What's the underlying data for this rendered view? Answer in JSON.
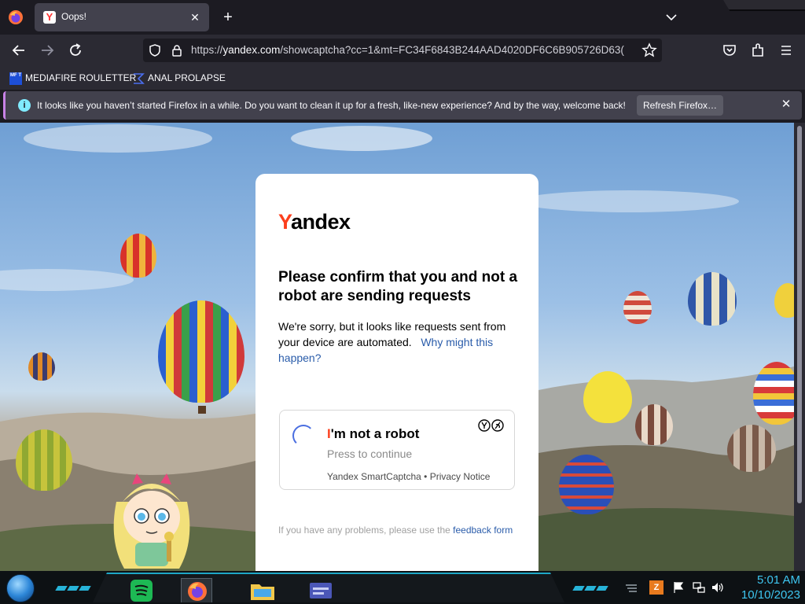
{
  "browser": {
    "tab": {
      "title": "Oops!",
      "favicon_letter": "Y"
    },
    "url": {
      "prefix": "https://",
      "host": "yandex.com",
      "path": "/showcaptcha?cc=1&mt=FC34F6843B244AAD4020DF6C6B905726D63("
    }
  },
  "bookmarks": [
    {
      "label": "MEDIAFIRE ROULETTER",
      "icon": "mediafire-icon",
      "icon_text": "MF T"
    },
    {
      "label": "ANAL PROLAPSE",
      "icon": "bookmark-folder-icon"
    }
  ],
  "notification": {
    "message": "It looks like you haven’t started Firefox in a while. Do you want to clean it up for a fresh, like-new experience? And by the way, welcome back!",
    "button": "Refresh Firefox…"
  },
  "page": {
    "logo_first": "Y",
    "logo_rest": "andex",
    "heading": "Please confirm that you and not a robot are sending requests",
    "body_text": "We're sorry, but it looks like requests sent from your device are automated.",
    "body_link": "Why might this happen?",
    "captcha": {
      "label_first": "I",
      "label_rest": "'m not a robot",
      "subtext": "Press to continue",
      "provider": "Yandex SmartCaptcha",
      "separator": " • ",
      "privacy": "Privacy Notice"
    },
    "feedback_text": "If you have any problems, please use the",
    "feedback_link": "feedback form"
  },
  "taskbar": {
    "clock_time": "5:01 AM",
    "clock_date": "10/10/2023",
    "accent": "#27b3d8"
  },
  "colors": {
    "yandex_red": "#fc3f1d",
    "link_blue": "#2a5caa",
    "notice_accent": "#c882e6"
  }
}
